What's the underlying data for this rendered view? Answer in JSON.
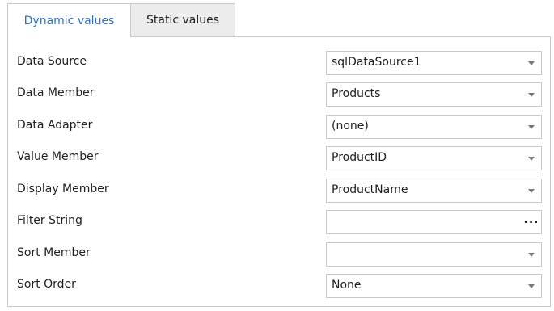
{
  "tabs": [
    {
      "label": "Dynamic values",
      "active": true
    },
    {
      "label": "Static values",
      "active": false
    }
  ],
  "accent_color": "#2a6fcf",
  "properties": [
    {
      "label": "Data Source",
      "value": "sqlDataSource1",
      "editor": "dropdown"
    },
    {
      "label": "Data Member",
      "value": "Products",
      "editor": "dropdown"
    },
    {
      "label": "Data Adapter",
      "value": "(none)",
      "editor": "dropdown"
    },
    {
      "label": "Value Member",
      "value": "ProductID",
      "editor": "dropdown"
    },
    {
      "label": "Display Member",
      "value": "ProductName",
      "editor": "dropdown"
    },
    {
      "label": "Filter String",
      "value": "",
      "editor": "ellipsis",
      "button_text": "..."
    },
    {
      "label": "Sort Member",
      "value": "",
      "editor": "dropdown"
    },
    {
      "label": "Sort Order",
      "value": "None",
      "editor": "dropdown"
    }
  ]
}
